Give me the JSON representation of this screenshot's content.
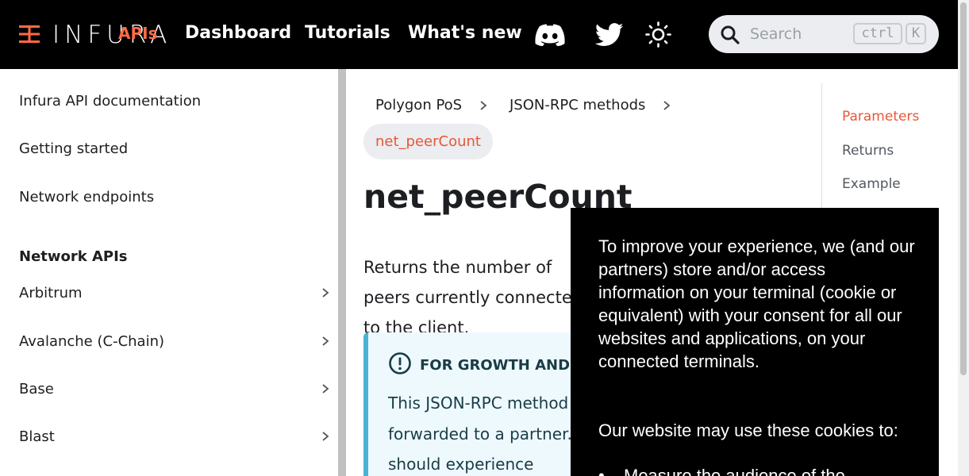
{
  "navbar": {
    "logo_text": "INFURA",
    "logo_sub": "APIs",
    "links": [
      "Dashboard",
      "Tutorials",
      "What's new"
    ],
    "icons": [
      "discord-icon",
      "twitter-icon",
      "sun-icon"
    ],
    "search": {
      "placeholder": "Search",
      "shortcut_key1": "ctrl",
      "shortcut_key2": "K"
    }
  },
  "sidebar": {
    "items": [
      {
        "label": "Infura API documentation"
      },
      {
        "label": "Getting started"
      },
      {
        "label": "Network endpoints"
      }
    ],
    "section_heading": "Network APIs",
    "networks": [
      {
        "label": "Arbitrum"
      },
      {
        "label": "Avalanche (C-Chain)"
      },
      {
        "label": "Base"
      },
      {
        "label": "Blast"
      }
    ]
  },
  "breadcrumb": {
    "items": [
      "Polygon PoS",
      "JSON-RPC methods"
    ],
    "active": "net_peerCount"
  },
  "main": {
    "title": "net_peerCount",
    "lead": "Returns the number of peers currently connected to the client.",
    "admonition": {
      "title": "FOR GROWTH AND CUSTOM PLANS ONLY",
      "body": "This JSON-RPC method will be forwarded to a partner. Infura should experience"
    }
  },
  "toc": {
    "items": [
      "Parameters",
      "Returns",
      "Example"
    ],
    "active_index": 0
  },
  "cookie_banner": {
    "paragraph1": "To improve your experience, we (and our partners) store and/or access information on your terminal (cookie or equivalent) with your consent for all our websites and applications, on your connected terminals.",
    "paragraph2": "Our website may use these cookies to:",
    "list_item": "Measure the audience of the"
  },
  "colors": {
    "accent": "#e8563a",
    "navbar_bg": "#000000",
    "admonition_border": "#4cb3d4",
    "admonition_bg": "#eef9fd"
  }
}
